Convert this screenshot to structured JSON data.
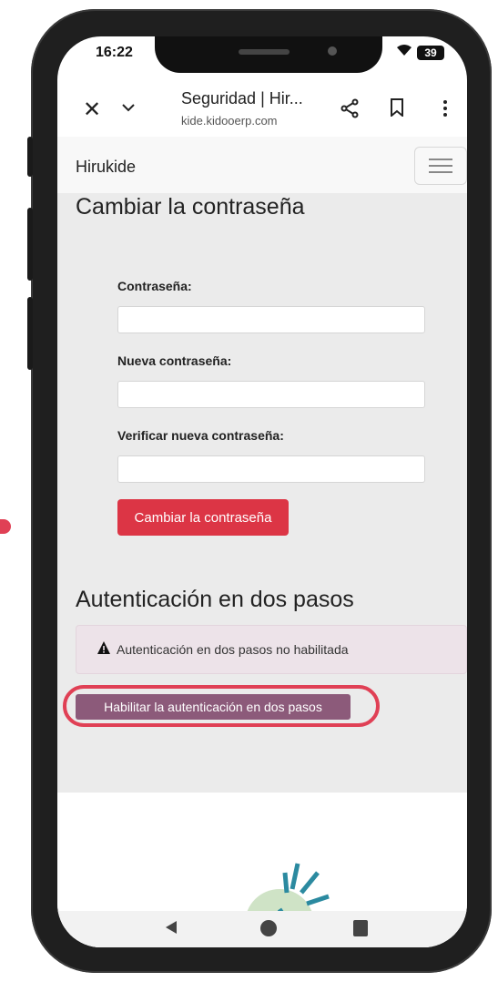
{
  "status_bar": {
    "time": "16:22",
    "battery": "39"
  },
  "browser": {
    "title": "Seguridad | Hir...",
    "url": "kide.kidooerp.com"
  },
  "navbar": {
    "brand": "Hirukide"
  },
  "change_password": {
    "heading": "Cambiar la contraseña",
    "fields": [
      {
        "label": "Contraseña:",
        "value": ""
      },
      {
        "label": "Nueva contraseña:",
        "value": ""
      },
      {
        "label": "Verificar nueva contraseña:",
        "value": ""
      }
    ],
    "submit_label": "Cambiar la contraseña"
  },
  "two_factor": {
    "heading": "Autenticación en dos pasos",
    "alert_text": "Autenticación en dos pasos no habilitada",
    "enable_label": "Habilitar la autenticación en dos pasos"
  },
  "colors": {
    "danger_button": "#dc3545",
    "enable_button": "#8c5a7a",
    "highlight_ring": "#e04055",
    "alert_bg": "#ede3e9"
  }
}
